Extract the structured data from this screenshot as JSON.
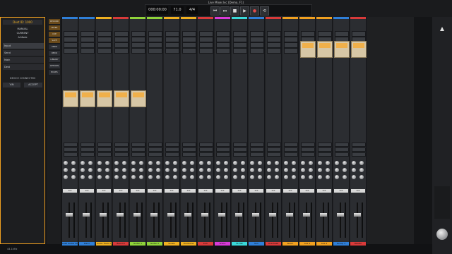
{
  "window": {
    "title": "Live Mixer.lvc (Demo, F1)"
  },
  "transport": {
    "tempo": "71.0",
    "meter": "4/4",
    "position": "000:00:00",
    "buttons": [
      "rewind",
      "fast-forward",
      "stop",
      "play",
      "record",
      "loop"
    ]
  },
  "left_panel": {
    "device_name": "Dest ID: 1000",
    "menu": [
      "MANUAL",
      "CURRENT",
      "A-Mode"
    ],
    "inputs": [
      "Input",
      "Send",
      "Main",
      "Dest"
    ],
    "footer_label": "DEVICE CONNECTED",
    "footer_buttons": [
      "Y/N",
      "ACCEPT"
    ]
  },
  "tool_column": {
    "items": [
      "RECORD",
      "MIXER",
      "CUE",
      "SAVE",
      "UNDO",
      "REDO",
      "LIBRARY",
      "OPTIONS",
      "BUSES"
    ]
  },
  "channel_strips": [
    {
      "name": "Lead Guitar Stereo",
      "color": "#2f7fd8",
      "value": "0.0"
    },
    {
      "name": "Piano",
      "color": "#2f7fd8",
      "value": "0.0"
    },
    {
      "name": "Audio Track 2",
      "color": "#f0b020",
      "value": "0.0"
    },
    {
      "name": "Bass DI",
      "color": "#d83a3a",
      "value": "0.0"
    },
    {
      "name": "Guitar 1",
      "color": "#8fd33a",
      "value": "0.0"
    },
    {
      "name": "Guitar 2",
      "color": "#8fd33a",
      "value": "0.0"
    },
    {
      "name": "Vocals",
      "color": "#f0b020",
      "value": "0.0"
    },
    {
      "name": "Trombone",
      "color": "#f0b020",
      "value": "0.0"
    },
    {
      "name": "Kick",
      "color": "#d83a3a",
      "value": "0.0"
    },
    {
      "name": "Snare",
      "color": "#d83ad8",
      "value": "0.0"
    },
    {
      "name": "Hi-Hat",
      "color": "#3ad8d8",
      "value": "0.0"
    },
    {
      "name": "Tom",
      "color": "#2f7fd8",
      "value": "0.0"
    },
    {
      "name": "Overhead",
      "color": "#d83a3a",
      "value": "0.0"
    },
    {
      "name": "Room",
      "color": "#f0a020",
      "value": "0.0"
    },
    {
      "name": "Aux 1",
      "color": "#f0a020",
      "value": "0.0"
    },
    {
      "name": "Aux 2",
      "color": "#f0a020",
      "value": "0.0"
    },
    {
      "name": "Group 1",
      "color": "#2f7fd8",
      "value": "0.0"
    },
    {
      "name": "Master",
      "color": "#d83a3a",
      "value": "0.0"
    }
  ],
  "status_bar": {
    "left": "44.1kHz",
    "center": "",
    "right": ""
  }
}
